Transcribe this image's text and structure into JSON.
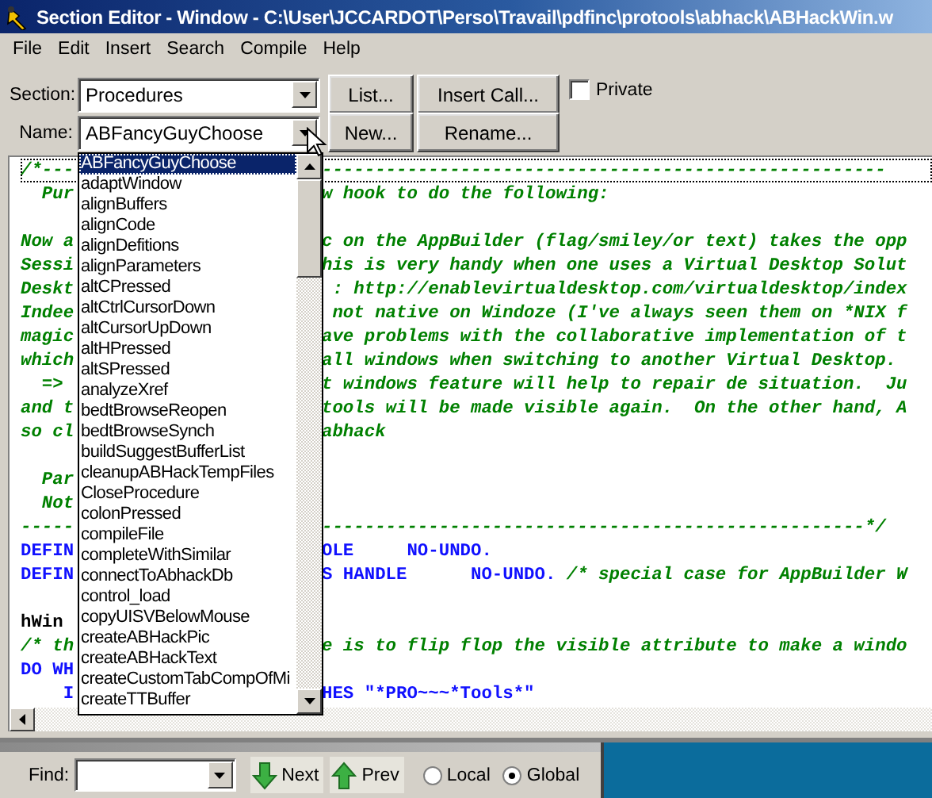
{
  "window": {
    "title": "Section Editor - Window - C:\\User\\JCCARDOT\\Perso\\Travail\\pdfinc\\protools\\abhack\\ABHackWin.w"
  },
  "menu": [
    "File",
    "Edit",
    "Insert",
    "Search",
    "Compile",
    "Help"
  ],
  "toolbar": {
    "rows": [
      {
        "label": "Section:",
        "value": "Procedures",
        "buttons": [
          "List...",
          "Insert Call..."
        ]
      },
      {
        "label": "Name:",
        "value": "ABFancyGuyChoose",
        "buttons": [
          "New...",
          "Rename..."
        ]
      }
    ],
    "private": {
      "label": "Private",
      "checked": false
    }
  },
  "dropdown": {
    "open": true,
    "items": [
      {
        "label": "ABFancyGuyChoose",
        "selected": true
      },
      {
        "label": "adaptWindow",
        "selected": false
      },
      {
        "label": "alignBuffers",
        "selected": false
      },
      {
        "label": "alignCode",
        "selected": false
      },
      {
        "label": "alignDefitions",
        "selected": false
      },
      {
        "label": "alignParameters",
        "selected": false
      },
      {
        "label": "altCPressed",
        "selected": false
      },
      {
        "label": "altCtrlCursorDown",
        "selected": false
      },
      {
        "label": "altCursorUpDown",
        "selected": false
      },
      {
        "label": "altHPressed",
        "selected": false
      },
      {
        "label": "altSPressed",
        "selected": false
      },
      {
        "label": "analyzeXref",
        "selected": false
      },
      {
        "label": "bedtBrowseReopen",
        "selected": false
      },
      {
        "label": "bedtBrowseSynch",
        "selected": false
      },
      {
        "label": "buildSuggestBufferList",
        "selected": false
      },
      {
        "label": "cleanupABHackTempFiles",
        "selected": false
      },
      {
        "label": "CloseProcedure",
        "selected": false
      },
      {
        "label": "colonPressed",
        "selected": false
      },
      {
        "label": "compileFile",
        "selected": false
      },
      {
        "label": "completeWithSimilar",
        "selected": false
      },
      {
        "label": "connectToAbhackDb",
        "selected": false
      },
      {
        "label": "control_load",
        "selected": false
      },
      {
        "label": "copyUISVBelowMouse",
        "selected": false
      },
      {
        "label": "createABHackPic",
        "selected": false
      },
      {
        "label": "createABHackText",
        "selected": false
      },
      {
        "label": "createCustomTabCompOfMi",
        "selected": false
      },
      {
        "label": "createTTBuffer",
        "selected": false
      }
    ]
  },
  "editor": {
    "lines": [
      {
        "current": true,
        "left": [
          {
            "text": "/*---",
            "kind": "comment"
          }
        ],
        "right": [
          {
            "text": "-----------------------------------------------------",
            "kind": "comment"
          }
        ]
      },
      {
        "current": false,
        "left": [
          {
            "text": "  Pur",
            "kind": "comment"
          }
        ],
        "right": [
          {
            "text": "w hook to do the following:",
            "kind": "comment"
          }
        ]
      },
      {
        "current": false
      },
      {
        "current": false,
        "left": [
          {
            "text": "Now a",
            "kind": "comment"
          }
        ],
        "right": [
          {
            "text": "c on the AppBuilder (flag/smiley/or text) takes the opp",
            "kind": "comment"
          }
        ]
      },
      {
        "current": false,
        "left": [
          {
            "text": "Sessi",
            "kind": "comment"
          }
        ],
        "right": [
          {
            "text": "his is very handy when one uses a Virtual Desktop Solut",
            "kind": "comment"
          }
        ]
      },
      {
        "current": false,
        "left": [
          {
            "text": "Deskt",
            "kind": "comment"
          }
        ],
        "right": [
          {
            "text": " : http://enablevirtualdesktop.com/virtualdesktop/index",
            "kind": "comment"
          }
        ]
      },
      {
        "current": false,
        "left": [
          {
            "text": "Indee",
            "kind": "comment"
          }
        ],
        "right": [
          {
            "text": " not native on Windoze (I've always seen them on *NIX f",
            "kind": "comment"
          }
        ]
      },
      {
        "current": false,
        "left": [
          {
            "text": "magic",
            "kind": "comment"
          }
        ],
        "right": [
          {
            "text": "ave problems with the collaborative implementation of t",
            "kind": "comment"
          }
        ]
      },
      {
        "current": false,
        "left": [
          {
            "text": "which",
            "kind": "comment"
          }
        ],
        "right": [
          {
            "text": "all windows when switching to another Virtual Desktop.",
            "kind": "comment"
          }
        ]
      },
      {
        "current": false,
        "left": [
          {
            "text": "  =>",
            "kind": "comment"
          }
        ],
        "right": [
          {
            "text": "t windows feature will help to repair de situation.  Ju",
            "kind": "comment"
          }
        ]
      },
      {
        "current": false,
        "left": [
          {
            "text": "and t",
            "kind": "comment"
          }
        ],
        "right": [
          {
            "text": "tools will be made visible again.  On the other hand, A",
            "kind": "comment"
          }
        ]
      },
      {
        "current": false,
        "left": [
          {
            "text": "so cl",
            "kind": "comment"
          }
        ],
        "right": [
          {
            "text": "abhack",
            "kind": "comment"
          }
        ]
      },
      {
        "current": false
      },
      {
        "current": false,
        "left": [
          {
            "text": "  Par",
            "kind": "comment"
          }
        ]
      },
      {
        "current": false,
        "left": [
          {
            "text": "  Not",
            "kind": "comment"
          }
        ]
      },
      {
        "current": false,
        "left": [
          {
            "text": "-----",
            "kind": "comment"
          }
        ],
        "right": [
          {
            "text": "---------------------------------------------------*/",
            "kind": "comment"
          }
        ]
      },
      {
        "current": false,
        "left": [
          {
            "text": "DEFIN",
            "kind": "keyword"
          }
        ],
        "right": [
          {
            "text": "OLE     NO-UNDO.",
            "kind": "keyword"
          }
        ]
      },
      {
        "current": false,
        "left": [
          {
            "text": "DEFIN",
            "kind": "keyword"
          }
        ],
        "right": [
          {
            "text": "S HANDLE      NO-UNDO.",
            "kind": "keyword"
          },
          {
            "text": " /* special case for AppBuilder W",
            "kind": "comment"
          }
        ]
      },
      {
        "current": false
      },
      {
        "current": false,
        "left": [
          {
            "text": "hWin",
            "kind": "plain"
          }
        ]
      },
      {
        "current": false,
        "left": [
          {
            "text": "/* th",
            "kind": "comment"
          }
        ],
        "right": [
          {
            "text": "e is to flip flop the visible attribute to make a windo",
            "kind": "comment"
          }
        ]
      },
      {
        "current": false,
        "left": [
          {
            "text": "DO WH",
            "kind": "keyword"
          }
        ]
      },
      {
        "current": false,
        "left": [
          {
            "text": "    I",
            "kind": "keyword"
          }
        ],
        "right": [
          {
            "text": "HES \"*PRO~~~*Tools*\"",
            "kind": "keyword"
          }
        ]
      }
    ]
  },
  "finder": {
    "label": "Find:",
    "buttons": [
      {
        "label": "Next",
        "kind": "down"
      },
      {
        "label": "Prev",
        "kind": "up"
      }
    ],
    "scope": [
      {
        "label": "Local",
        "selected": false
      },
      {
        "label": "Global",
        "selected": true
      }
    ]
  }
}
